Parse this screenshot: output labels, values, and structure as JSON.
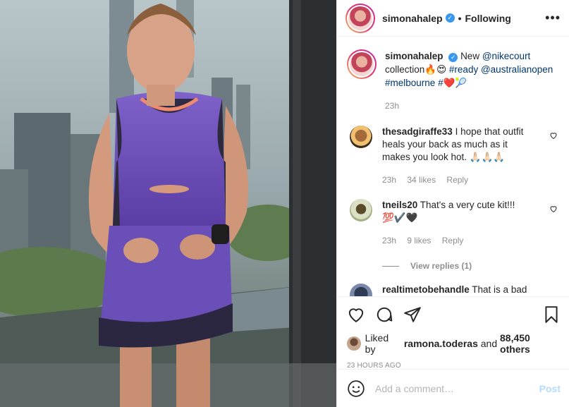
{
  "post": {
    "username": "simonahalep",
    "separator": "•",
    "follow_state": "Following",
    "more_label": "•••"
  },
  "caption": {
    "username": "simonahalep",
    "text_prefix": "New ",
    "mention1": "@nikecourt",
    "text_mid": " collection🔥😍 ",
    "hashtag1": "#ready",
    "mention2": "@australianopen",
    "hashtag2": "#melbourne",
    "hashtag3": "#",
    "emoji_tail": "❤️🎾",
    "time": "23h"
  },
  "comments": [
    {
      "username": "thesadgiraffe33",
      "text": "I hope that outfit heals your back as much as it makes you look hot. 🙏🏻🙏🏻🙏🏻",
      "time": "23h",
      "likes": "34 likes",
      "reply": "Reply"
    },
    {
      "username": "tneils20",
      "text": "That's a very cute kit!!!💯✔️🖤",
      "time": "23h",
      "likes": "9 likes",
      "reply": "Reply",
      "view_replies": "View replies (1)"
    },
    {
      "username": "realtimetobehandle",
      "text": "That is a bad"
    }
  ],
  "engagement": {
    "liked_by_prefix": "Liked by ",
    "liked_by_user": "ramona.toderas",
    "liked_by_mid": " and ",
    "liked_by_count": "88,450 others",
    "time_ago": "23 HOURS AGO"
  },
  "composer": {
    "placeholder": "Add a comment…",
    "post_label": "Post"
  },
  "colors": {
    "link": "#00376b",
    "muted": "#8e8e8e",
    "verified": "#3897f0",
    "post_disabled": "#b3dbff"
  }
}
